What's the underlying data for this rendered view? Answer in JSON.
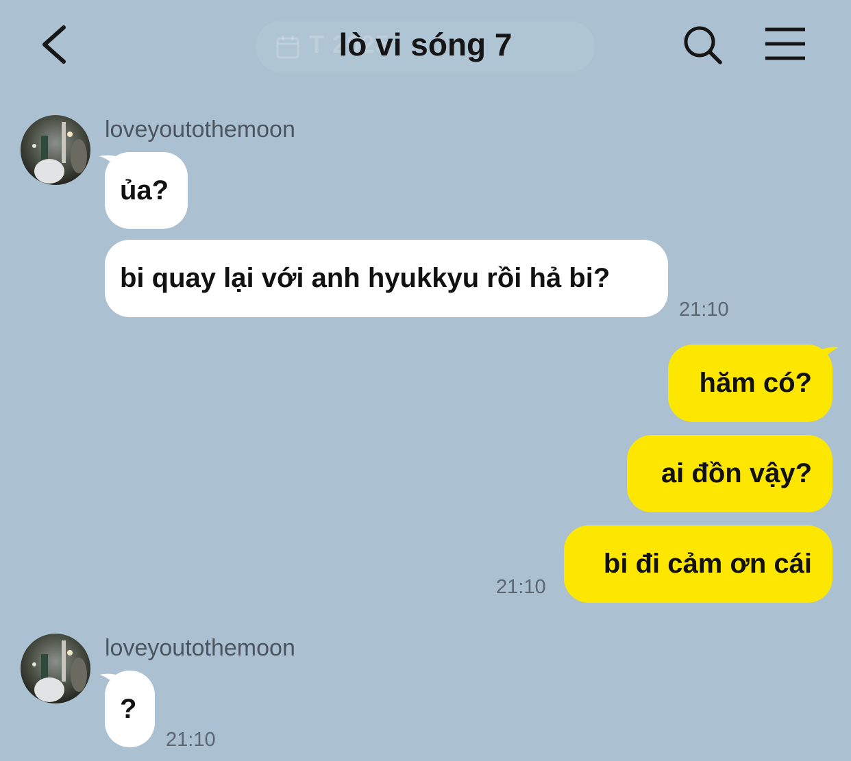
{
  "header": {
    "title": "lò vi sóng 7",
    "date_pill_text": "T          2025",
    "icons": {
      "back": "chevron-left-icon",
      "search": "search-icon",
      "menu": "menu-icon",
      "calendar": "calendar-icon"
    }
  },
  "messages": [
    {
      "sender": "loveyoutothemoon",
      "direction": "incoming",
      "texts": [
        "ủa?",
        "bi quay lại với anh hyukkyu rồi hả bi?"
      ],
      "time": "21:10"
    },
    {
      "direction": "outgoing",
      "texts": [
        "hăm có?",
        "ai đồn vậy?",
        "bi đi cảm ơn cái"
      ],
      "time": "21:10"
    },
    {
      "sender": "loveyoutothemoon",
      "direction": "incoming",
      "texts": [
        "?"
      ],
      "time": "21:10"
    }
  ],
  "colors": {
    "background": "#abc1d1",
    "incoming_bubble": "#ffffff",
    "outgoing_bubble": "#fde700"
  }
}
